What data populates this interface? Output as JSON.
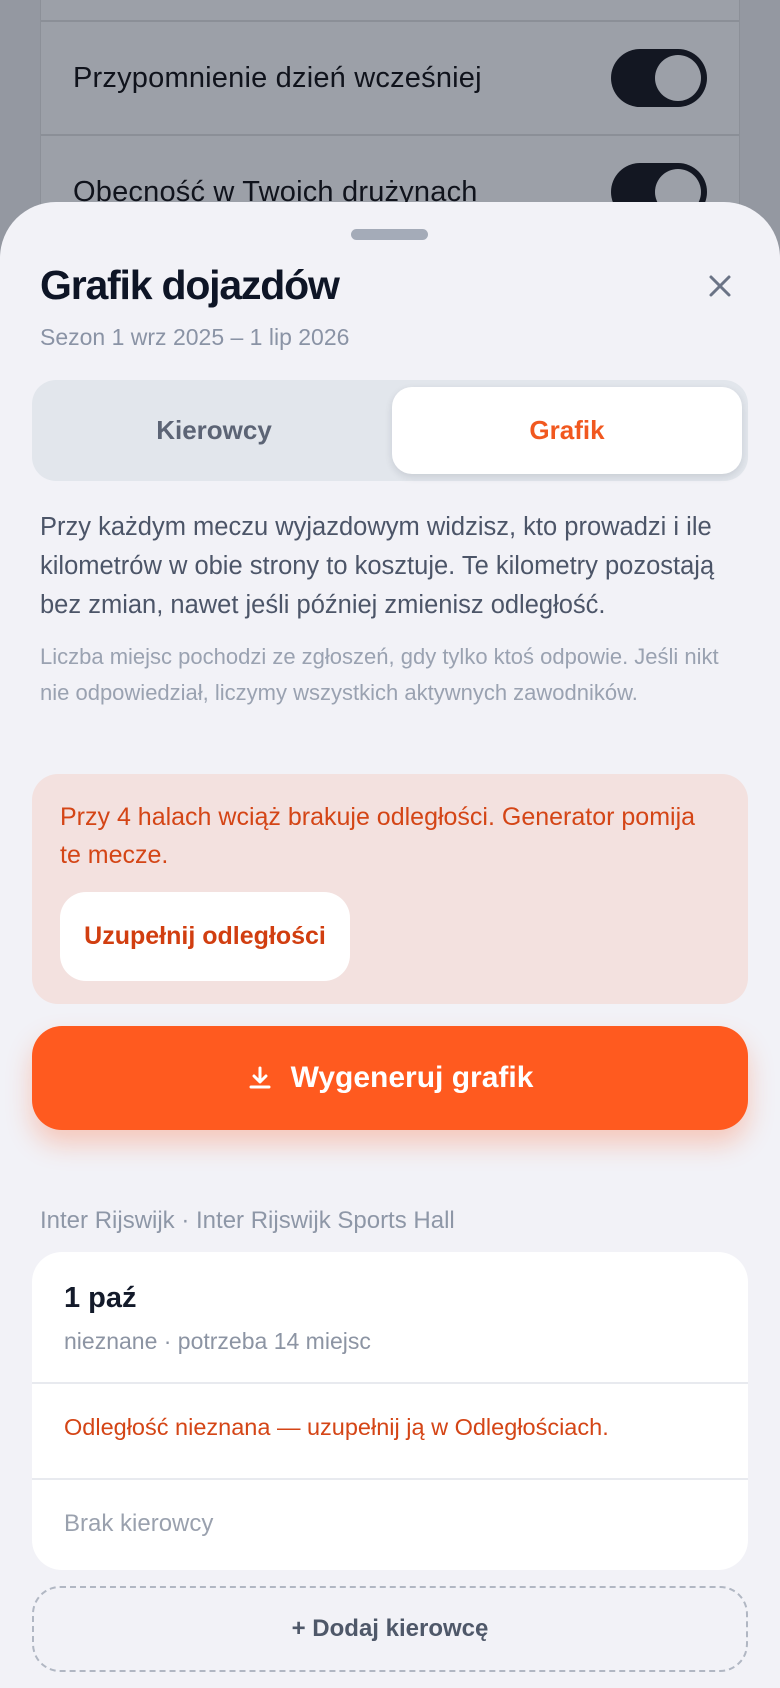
{
  "background": {
    "rows": [
      {
        "label": "Przypomnienie dzień wcześniej",
        "toggle_on": true
      },
      {
        "label": "Obecność w Twoich drużynach",
        "toggle_on": true
      }
    ]
  },
  "sheet": {
    "title": "Grafik dojazdów",
    "subtitle": "Sezon 1 wrz 2025 – 1 lip 2026",
    "close_icon": "close-icon",
    "tabs": [
      {
        "label": "Kierowcy",
        "selected": false
      },
      {
        "label": "Grafik",
        "selected": true
      }
    ],
    "description": "Przy każdym meczu wyjazdowym widzisz, kto prowadzi i ile kilometrów w obie strony to kosztuje. Te kilometry pozostają bez zmian, nawet jeśli później zmienisz odległość.",
    "note": "Liczba miejsc pochodzi ze zgłoszeń, gdy tylko ktoś odpowie. Jeśli nikt nie odpowiedział, liczymy wszystkich aktywnych zawodników.",
    "warning": {
      "text": "Przy 4 halach wciąż brakuje odległości. Generator pomija te mecze.",
      "button_label": "Uzupełnij odległości"
    },
    "generate_button": {
      "label": "Wygeneruj grafik",
      "icon": "download-icon"
    },
    "section_label": "Inter Rijswijk · Inter Rijswijk Sports Hall",
    "match": {
      "date": "1 paź",
      "meta": "nieznane · potrzeba 14 miejsc",
      "distance_warning": "Odległość nieznana — uzupełnij ją w Odległościach.",
      "driver_status": "Brak kierowcy"
    },
    "add_driver_label": "+ Dodaj kierowcę"
  },
  "colors": {
    "accent": "#ff5a1f",
    "warning_text": "#d44516",
    "warning_bg": "#f3e1df",
    "sheet_bg": "#f2f2f7"
  }
}
